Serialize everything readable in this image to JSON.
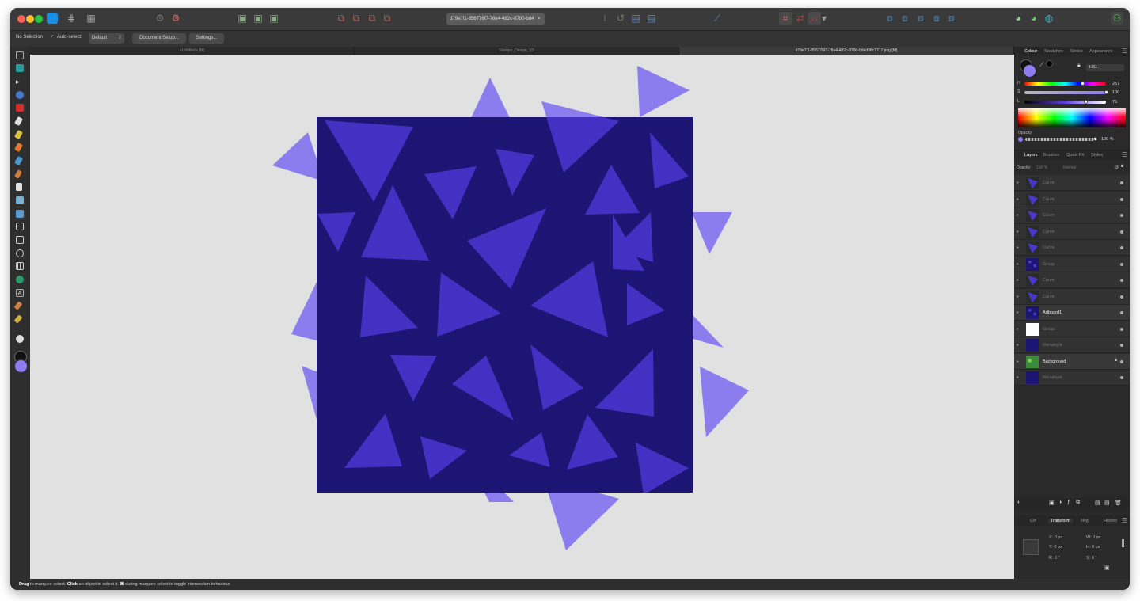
{
  "window": {
    "document_title": "d79e7f1-356776f7-78e4-482c-8790-bd4",
    "document_title_close": "×"
  },
  "context_bar": {
    "selection": "No Selection",
    "auto_select_label": "Auto-select:",
    "auto_select_checked": true,
    "auto_select_value": "Default",
    "document_setup": "Document Setup...",
    "settings": "Settings..."
  },
  "tabs": [
    {
      "label": "<Untitled> [M]",
      "active": false
    },
    {
      "label": "Stamps_Design_V3",
      "active": false
    },
    {
      "label": "d79e7f1-356776f7-78e4-482c-8790-bd4d08c7717.png [M]",
      "active": true
    }
  ],
  "colour_panel": {
    "tabs": [
      "Colour",
      "Swatches",
      "Stroke",
      "Appearance"
    ],
    "active_tab": "Colour",
    "mode": "HSL",
    "h_label": "H",
    "h_value": "257",
    "s_label": "S",
    "s_value": "100",
    "l_label": "L",
    "l_value": "75",
    "opacity_label": "Opacity",
    "opacity_value": "100 %",
    "fill_color": "#8f7cf0",
    "h_fraction": 0.714,
    "s_fraction": 1.0,
    "l_fraction": 0.75
  },
  "layers_panel": {
    "tabs": [
      "Layers",
      "Brushes",
      "Quick FX",
      "Styles"
    ],
    "active_tab": "Layers",
    "opacity_label": "Opacity:",
    "opacity_value": "100 %",
    "blend_mode": "Normal",
    "layers": [
      {
        "name": "Curve",
        "thumb": "triangle",
        "bright": false
      },
      {
        "name": "Curve",
        "thumb": "triangle",
        "bright": false
      },
      {
        "name": "Curve",
        "thumb": "triangle",
        "bright": false
      },
      {
        "name": "Curve",
        "thumb": "triangle",
        "bright": false
      },
      {
        "name": "Curve",
        "thumb": "triangle",
        "bright": false
      },
      {
        "name": "Group",
        "thumb": "pattern",
        "bright": false
      },
      {
        "name": "Curve",
        "thumb": "triangle",
        "bright": false
      },
      {
        "name": "Curve",
        "thumb": "triangle",
        "bright": false
      },
      {
        "name": "Artboard1",
        "thumb": "pattern",
        "bright": true
      },
      {
        "name": "Group",
        "thumb": "group",
        "bright": false
      },
      {
        "name": "Rectangle",
        "thumb": "navy",
        "bright": false
      },
      {
        "name": "Background",
        "thumb": "green",
        "bright": true,
        "locked": true
      },
      {
        "name": "Rectangle",
        "thumb": "navy",
        "bright": false
      }
    ]
  },
  "transform_panel": {
    "tabs": [
      "Ctr",
      "Transform",
      "Nvg",
      "History"
    ],
    "active_tab": "Transform",
    "x": "X:  0 px",
    "y": "Y:  0 px",
    "w": "W:  0 px",
    "h": "H:  0 px",
    "r": "R:  0 °",
    "s": "S:  0 °"
  },
  "status_bar": {
    "b1": "Drag",
    "t1": " to marquee select. ",
    "b2": "Click",
    "t2": " an object to select it. ",
    "b3": "⌘",
    "t3": " during marquee select to toggle intersection behaviour."
  },
  "artwork": {
    "background_color": "#1d1573",
    "inner_triangle_color": "#4430c2",
    "outer_triangle_color": "#8c7ced"
  },
  "icons": {
    "app_logo": "affinity-designer-logo-icon",
    "toolbar": [
      "personas-icon",
      "move-tool-icon",
      "node-tool-icon",
      "pen-tool-icon",
      "shape-tool-icon",
      "text-tool-icon",
      "crop-tool-icon",
      "zoom-tool-icon",
      "colour-picker-icon"
    ]
  }
}
